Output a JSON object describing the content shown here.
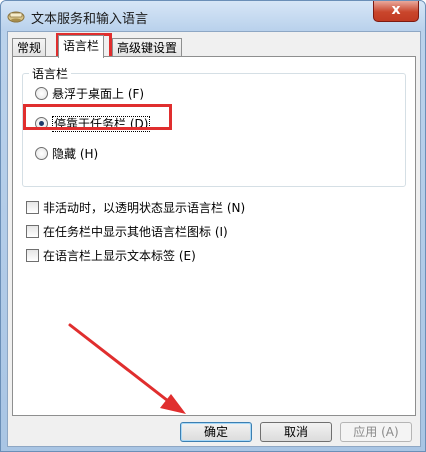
{
  "window": {
    "title": "文本服务和输入语言",
    "close_glyph": "x"
  },
  "tabs": [
    {
      "label": "常规"
    },
    {
      "label": "语言栏",
      "active": true
    },
    {
      "label": "高级键设置"
    }
  ],
  "language_bar_group": {
    "legend": "语言栏",
    "options": [
      {
        "label": "悬浮于桌面上 (F)",
        "checked": false
      },
      {
        "label": "停靠于任务栏 (D)",
        "checked": true
      },
      {
        "label": "隐藏 (H)",
        "checked": false
      }
    ]
  },
  "checkboxes": [
    {
      "label": "非活动时，以透明状态显示语言栏 (N)",
      "checked": false
    },
    {
      "label": "在任务栏中显示其他语言栏图标 (I)",
      "checked": false
    },
    {
      "label": "在语言栏上显示文本标签 (E)",
      "checked": false
    }
  ],
  "buttons": {
    "ok": "确定",
    "cancel": "取消",
    "apply": "应用 (A)"
  },
  "annotation": {
    "highlight_color": "#e02e2e"
  }
}
